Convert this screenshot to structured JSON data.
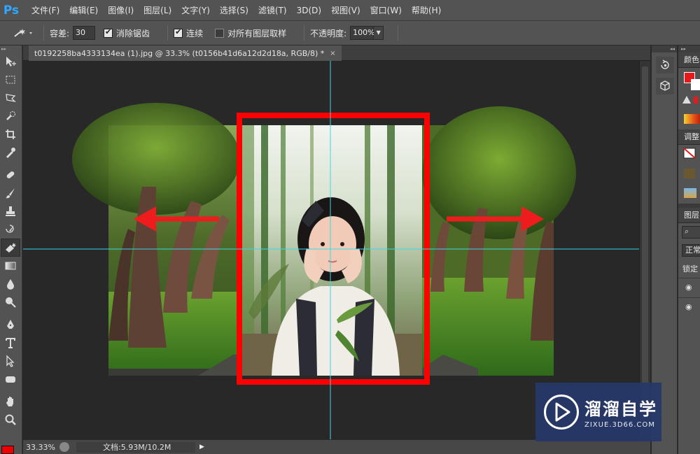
{
  "app": {
    "logo": "Ps"
  },
  "menu": [
    "文件(F)",
    "编辑(E)",
    "图像(I)",
    "图层(L)",
    "文字(Y)",
    "选择(S)",
    "滤镜(T)",
    "3D(D)",
    "视图(V)",
    "窗口(W)",
    "帮助(H)"
  ],
  "options": {
    "tolerance_label": "容差:",
    "tolerance_value": "30",
    "antialias_label": "消除锯齿",
    "antialias_checked": true,
    "contiguous_label": "连续",
    "contiguous_checked": true,
    "sample_all_label": "对所有图层取样",
    "sample_all_checked": false,
    "opacity_label": "不透明度:",
    "opacity_value": "100%"
  },
  "document": {
    "tab_title": "t0192258ba4333134ea (1).jpg @ 33.3% (t0156b41d6a12d2d18a, RGB/8) *",
    "close_glyph": "×"
  },
  "status": {
    "zoom": "33.33%",
    "doc_info": "文档:5.93M/10.2M"
  },
  "right_panel": {
    "color_header": "颜色",
    "adjust_header": "调整",
    "layers_header": "图层",
    "blend_mode": "正常",
    "lock_label": "锁定",
    "foreground_color": "#e8191a"
  },
  "watermark": {
    "title": "溜溜自学",
    "subtitle": "ZIXUE.3D66.COM"
  },
  "colors": {
    "guide": "#3ad8e6",
    "highlight_frame": "#ff0000",
    "arrow": "#ee1c1c"
  },
  "icons": [
    "move-icon",
    "marquee-icon",
    "lasso-icon",
    "quick-select-icon",
    "crop-icon",
    "eyedropper-icon",
    "healing-icon",
    "brush-icon",
    "stamp-icon",
    "history-brush-icon",
    "eraser-icon",
    "gradient-icon",
    "blur-icon",
    "dodge-icon",
    "pen-icon",
    "type-icon",
    "path-select-icon",
    "shape-icon",
    "hand-icon",
    "zoom-icon"
  ]
}
